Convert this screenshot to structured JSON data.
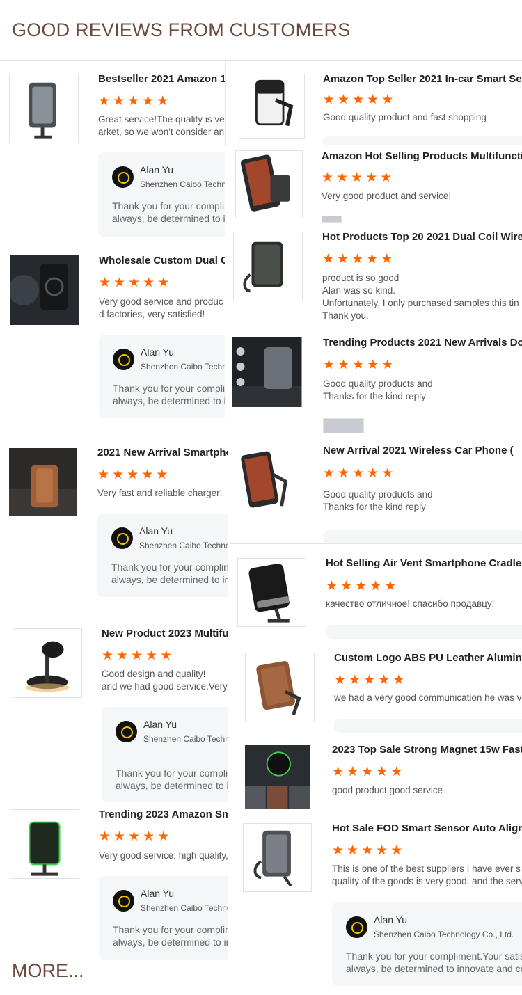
{
  "page": {
    "title": "GOOD REVIEWS FROM CUSTOMERS",
    "more_label": "MORE...",
    "star_char": "★",
    "star_color": "#ff6600",
    "title_color": "#6b4a3c"
  },
  "left_reviews": [
    {
      "product": "Bestseller 2021 Amazon 1",
      "stars": 5,
      "review": "Great service!The quality is ve\narket, so we won't consider an",
      "supplier": {
        "name": "Alan Yu",
        "company": "Shenzhen Caibo Techno",
        "reply": "Thank you for your complir\nalways, be determined to ir"
      }
    },
    {
      "product": "Wholesale Custom Dual C",
      "stars": 5,
      "review": "Very good service and produc\nd factories, very satisfied!",
      "supplier": {
        "name": "Alan Yu",
        "company": "Shenzhen Caibo Technol",
        "reply": "Thank you for your complim\nalways, be determined to inr"
      }
    },
    {
      "product": "2021 New Arrival Smartpho",
      "stars": 5,
      "review": "Very fast and reliable charger!",
      "supplier": {
        "name": "Alan Yu",
        "company": "Shenzhen Caibo Techno'",
        "reply": "Thank you for your complin\nalways, be determined to in"
      }
    },
    {
      "product": "New Product 2023 Multifu",
      "stars": 5,
      "review": "Good design and quality!\nand we had good service.Very",
      "supplier": {
        "name": "Alan Yu",
        "company": "Shenzhen Caibo Techno",
        "reply": "Thank you for your complir\nalways, be determined to ir"
      }
    },
    {
      "product": "Trending 2023 Amazon Sm",
      "stars": 5,
      "review": "Very good service, high quality,",
      "supplier": {
        "name": "Alan Yu",
        "company": "Shenzhen Caibo Technol",
        "reply": "Thank you for your complin\nalways, be determined to in"
      }
    }
  ],
  "right_reviews": [
    {
      "product": "Amazon Top Seller 2021 In-car Smart Senso",
      "stars": 5,
      "review": "Good quality product and fast shopping"
    },
    {
      "product": "Amazon Hot Selling Products Multifunctio",
      "stars": 5,
      "review": "Very good product and service!"
    },
    {
      "product": "Hot Products Top 20 2021 Dual Coil Wirel",
      "stars": 5,
      "review": "product is so good\nAlan was so kind.\nUnfortunately, I only purchased samples this tin\nThank you."
    },
    {
      "product": "Trending Products 2021 New Arrivals Do",
      "stars": 5,
      "review": "Good quality products and\nThanks for the kind reply"
    },
    {
      "product": "New Arrival 2021 Wireless Car Phone (",
      "stars": 5,
      "review": "Good quality products and\nThanks for the kind reply"
    },
    {
      "product": "Hot Selling Air Vent Smartphone Cradle (",
      "stars": 5,
      "review": "качество отличное! спасибо продавцу!"
    },
    {
      "product": "Custom Logo ABS PU Leather Aluminu",
      "stars": 5,
      "review": "we had a very good communication he was v"
    },
    {
      "product": "2023 Top Sale Strong Magnet 15w Fast",
      "stars": 5,
      "review": "good product good service"
    },
    {
      "product": "Hot Sale FOD Smart Sensor Auto Alignr",
      "stars": 5,
      "review": "This is one of the best suppliers I have ever s\nquality of the goods is very good, and the serv",
      "supplier": {
        "name": "Alan Yu",
        "company": "Shenzhen Caibo Technology Co., Ltd.",
        "reply": "Thank you for your compliment.Your satis\nalways, be determined to innovate and cor"
      }
    }
  ]
}
